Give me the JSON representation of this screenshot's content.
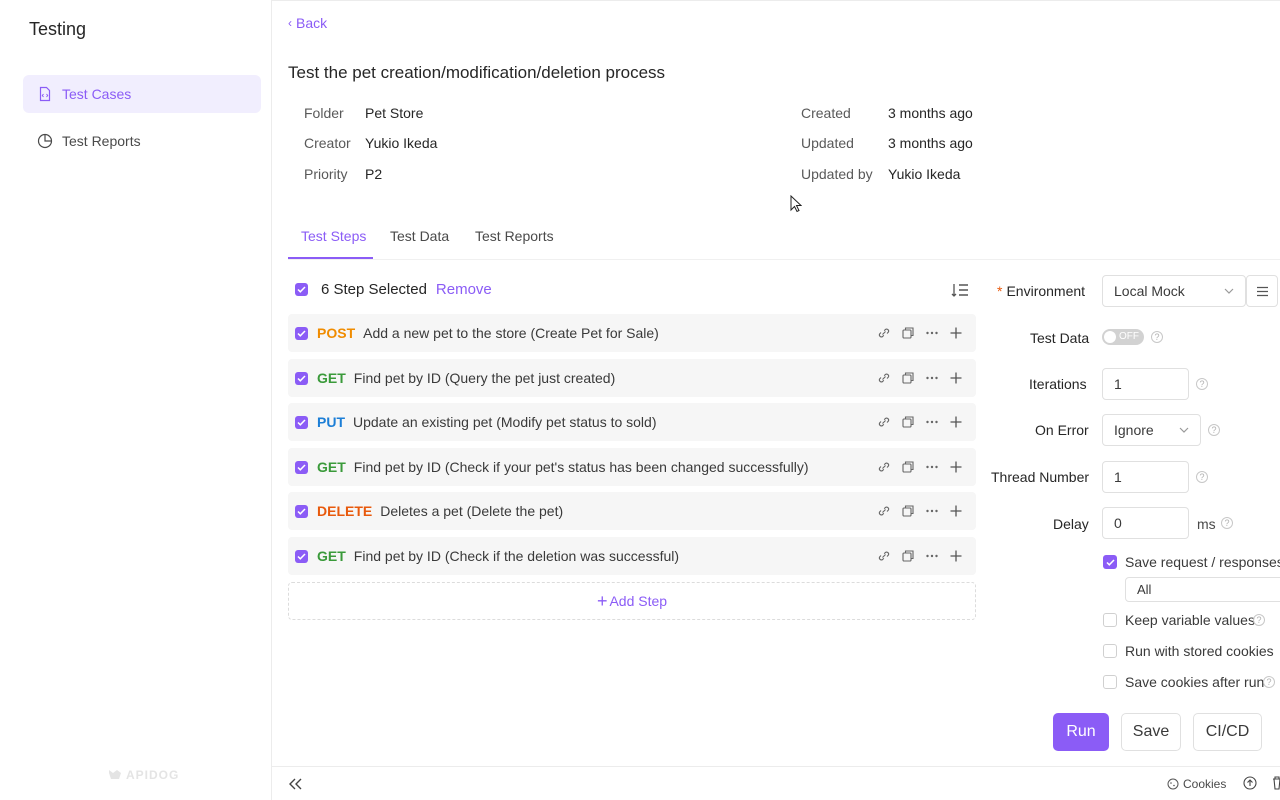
{
  "sidebar": {
    "title": "Testing",
    "items": [
      {
        "label": "Test Cases"
      },
      {
        "label": "Test Reports"
      }
    ],
    "logo_text": "APIDOG"
  },
  "header": {
    "back_label": "Back",
    "title": "Test the pet creation/modification/deletion process"
  },
  "meta": {
    "folder_label": "Folder",
    "folder_value": "Pet Store",
    "creator_label": "Creator",
    "creator_value": "Yukio Ikeda",
    "priority_label": "Priority",
    "priority_value": "P2",
    "created_label": "Created",
    "created_value": "3 months ago",
    "updated_label": "Updated",
    "updated_value": "3 months ago",
    "updated_by_label": "Updated by",
    "updated_by_value": "Yukio Ikeda"
  },
  "tabs": [
    {
      "label": "Test Steps"
    },
    {
      "label": "Test Data"
    },
    {
      "label": "Test Reports"
    }
  ],
  "selection": {
    "text": "6 Step Selected",
    "remove_label": "Remove"
  },
  "steps": [
    {
      "method": "POST",
      "name": "Add a new pet to the store (Create Pet for Sale)"
    },
    {
      "method": "GET",
      "name": "Find pet by ID (Query the pet just created)"
    },
    {
      "method": "PUT",
      "name": "Update an existing pet (Modify pet status to sold)"
    },
    {
      "method": "GET",
      "name": "Find pet by ID (Check if your pet's status has been changed successfully)"
    },
    {
      "method": "DELETE",
      "name": "Deletes a pet (Delete the pet)"
    },
    {
      "method": "GET",
      "name": "Find pet by ID (Check if the deletion was successful)"
    }
  ],
  "add_step_label": "Add Step",
  "run_settings": {
    "environment_label": "Environment",
    "environment_required_mark": "*",
    "environment_value": "Local Mock",
    "test_data_label": "Test Data",
    "test_data_toggle": "OFF",
    "iterations_label": "Iterations",
    "iterations_value": "1",
    "on_error_label": "On Error",
    "on_error_value": "Ignore",
    "thread_label": "Thread Number",
    "thread_value": "1",
    "delay_label": "Delay",
    "delay_value": "0",
    "delay_unit": "ms",
    "save_req_label": "Save request / responses",
    "save_req_scope": "All",
    "keep_vars_label": "Keep variable values",
    "stored_cookies_label": "Run with stored cookies",
    "save_cookies_label": "Save cookies after run"
  },
  "buttons": {
    "run": "Run",
    "save": "Save",
    "cicd": "CI/CD"
  },
  "bottom": {
    "cookies_label": "Cookies"
  },
  "colors": {
    "accent": "#8b5cf6",
    "post": "#f08c00",
    "get": "#3a9a3a",
    "put": "#1c7ed6",
    "delete": "#e8590c"
  }
}
